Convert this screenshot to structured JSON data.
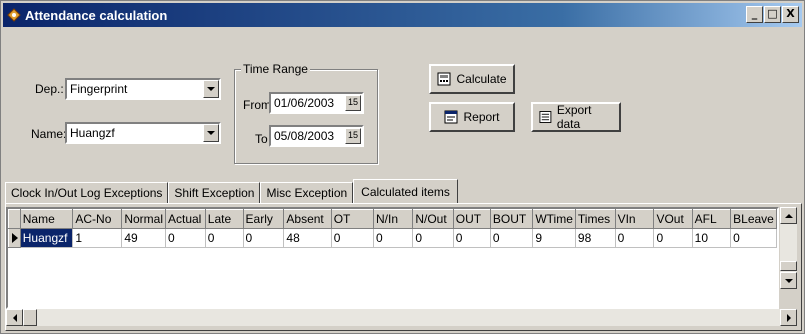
{
  "window": {
    "title": "Attendance calculation",
    "controls": [
      "_",
      "□",
      "X"
    ]
  },
  "filters": {
    "dept_label": "Dep.:",
    "dept_value": "Fingerprint",
    "name_label": "Name:",
    "name_value": "Huangzf"
  },
  "time_range": {
    "title": "Time Range",
    "from_label": "From",
    "from_value": "01/06/2003",
    "to_label": "To",
    "to_value": "05/08/2003",
    "picker_glyph": "15"
  },
  "buttons": {
    "calculate": "Calculate",
    "report": "Report",
    "export": "Export data"
  },
  "tabs": [
    {
      "label": "Clock In/Out Log Exceptions"
    },
    {
      "label": "Shift Exception"
    },
    {
      "label": "Misc Exception"
    },
    {
      "label": "Calculated items",
      "active": true
    }
  ],
  "grid": {
    "columns": [
      "Name",
      "AC-No",
      "Normal",
      "Actual",
      "Late",
      "Early",
      "Absent",
      "OT",
      "N/In",
      "N/Out",
      "OUT",
      "BOUT",
      "WTime",
      "Times",
      "VIn",
      "VOut",
      "AFL",
      "BLeave"
    ],
    "rows": [
      [
        "Huangzf",
        "1",
        "49",
        "0",
        "0",
        "0",
        "48",
        "0",
        "0",
        "0",
        "0",
        "0",
        "9",
        "98",
        "0",
        "0",
        "10",
        "0"
      ]
    ]
  },
  "colors": {
    "title_bar": "#0a246a",
    "face": "#d4d0c8",
    "selection": "#0a246a"
  }
}
